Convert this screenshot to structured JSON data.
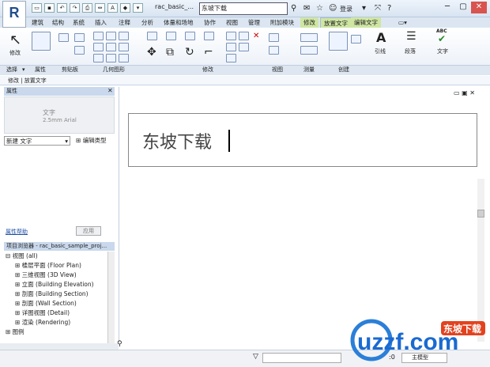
{
  "app": {
    "logo": "R",
    "doc_title": "rac_basic_...",
    "search_value": "东坡下载",
    "login": "登录"
  },
  "tabs": [
    "建筑",
    "结构",
    "系统",
    "插入",
    "注释",
    "分析",
    "体量和场地",
    "协作",
    "视图",
    "管理",
    "附加模块",
    "修改",
    "放置文字",
    "编辑文字"
  ],
  "ribbon": {
    "modify_label": "修改",
    "panels": [
      "选择",
      "属性",
      "剪贴板",
      "几何图形",
      "修改",
      "视图",
      "测量",
      "创建"
    ],
    "select_arrow": "▾",
    "leader": "引线",
    "paragraph": "段落",
    "text": "文字"
  },
  "context_bar": "修改 | 放置文字",
  "properties": {
    "header": "属性",
    "type_name": "文字",
    "type_sub": "2.5mm Arial",
    "type_select": "新建 文字",
    "edit_type": "编辑类型",
    "help": "属性帮助",
    "apply": "应用"
  },
  "browser": {
    "header": "项目浏览器 - rac_basic_sample_proj...",
    "items": [
      "视图 (all)",
      "楼层平面 (Floor Plan)",
      "三维视图 (3D View)",
      "立面 (Building Elevation)",
      "剖面 (Building Section)",
      "剖面 (Wall Section)",
      "详图视图 (Detail)",
      "渲染 (Rendering)",
      "图例"
    ]
  },
  "canvas": {
    "text": "东坡下载"
  },
  "status": {
    "count": ":0",
    "model": "主模型"
  },
  "watermark": {
    "brand": "uzzf.com",
    "site": "东坡下载"
  }
}
